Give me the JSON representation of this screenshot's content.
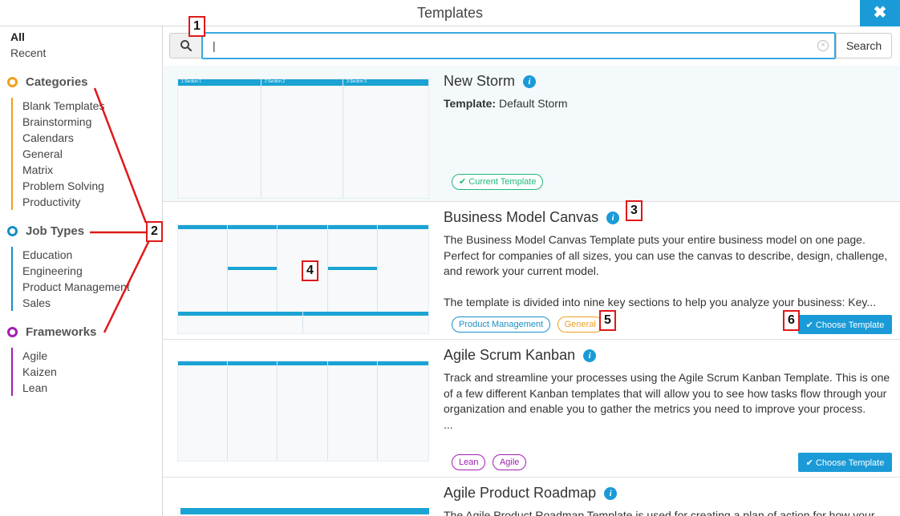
{
  "window": {
    "title": "Templates",
    "close_glyph": "✖"
  },
  "sidebar": {
    "top_links": [
      "All",
      "Recent"
    ],
    "groups": [
      {
        "name": "Categories",
        "color": "#f0a020",
        "items": [
          "Blank Templates",
          "Brainstorming",
          "Calendars",
          "General",
          "Matrix",
          "Problem Solving",
          "Productivity"
        ]
      },
      {
        "name": "Job Types",
        "color": "#1a8fc6",
        "items": [
          "Education",
          "Engineering",
          "Product Management",
          "Sales"
        ]
      },
      {
        "name": "Frameworks",
        "color": "#a020b0",
        "items": [
          "Agile",
          "Kaizen",
          "Lean"
        ]
      }
    ]
  },
  "search": {
    "value": "|",
    "placeholder": "",
    "button_label": "Search",
    "clear_glyph": "×"
  },
  "templates": [
    {
      "title": "New Storm",
      "template_label": "Template:",
      "template_value": "Default Storm",
      "badge": "✔ Current Template",
      "thumb_headers": [
        "1 Section 1",
        "2 Section 2",
        "3 Section 3"
      ]
    },
    {
      "title": "Business Model Canvas",
      "desc": [
        "The Business Model Canvas Template puts your entire business model on one page. Perfect for companies of all sizes, you can use the canvas to describe, design, challenge, and rework your current model.",
        "The template is divided into nine key sections to help you analyze your business: Key..."
      ],
      "tags": [
        "Product Management",
        "General"
      ],
      "button_label": "✔ Choose Template"
    },
    {
      "title": "Agile Scrum Kanban",
      "desc": [
        "Track and streamline your processes using the Agile Scrum Kanban Template. This is one of a few different Kanban templates that will allow you to see how tasks flow through your organization and enable you to gather the metrics you need to improve your process.",
        "..."
      ],
      "tags": [
        "Lean",
        "Agile"
      ],
      "button_label": "✔ Choose Template"
    },
    {
      "title": "Agile Product Roadmap",
      "desc": [
        "The Agile Product Roadmap Template is used for creating a plan of action for how your"
      ]
    }
  ],
  "callouts": [
    "1",
    "2",
    "3",
    "4",
    "5",
    "6"
  ],
  "colors": {
    "accent": "#1a9bd7",
    "callout": "#e01818",
    "tag_blue": "#1a8fc6",
    "tag_orange": "#f0a020",
    "tag_purple": "#a020b0",
    "badge_green": "#1fb87a"
  },
  "icons": {
    "search": "search-icon",
    "info": "info-icon",
    "close": "close-icon",
    "check": "check-icon"
  }
}
